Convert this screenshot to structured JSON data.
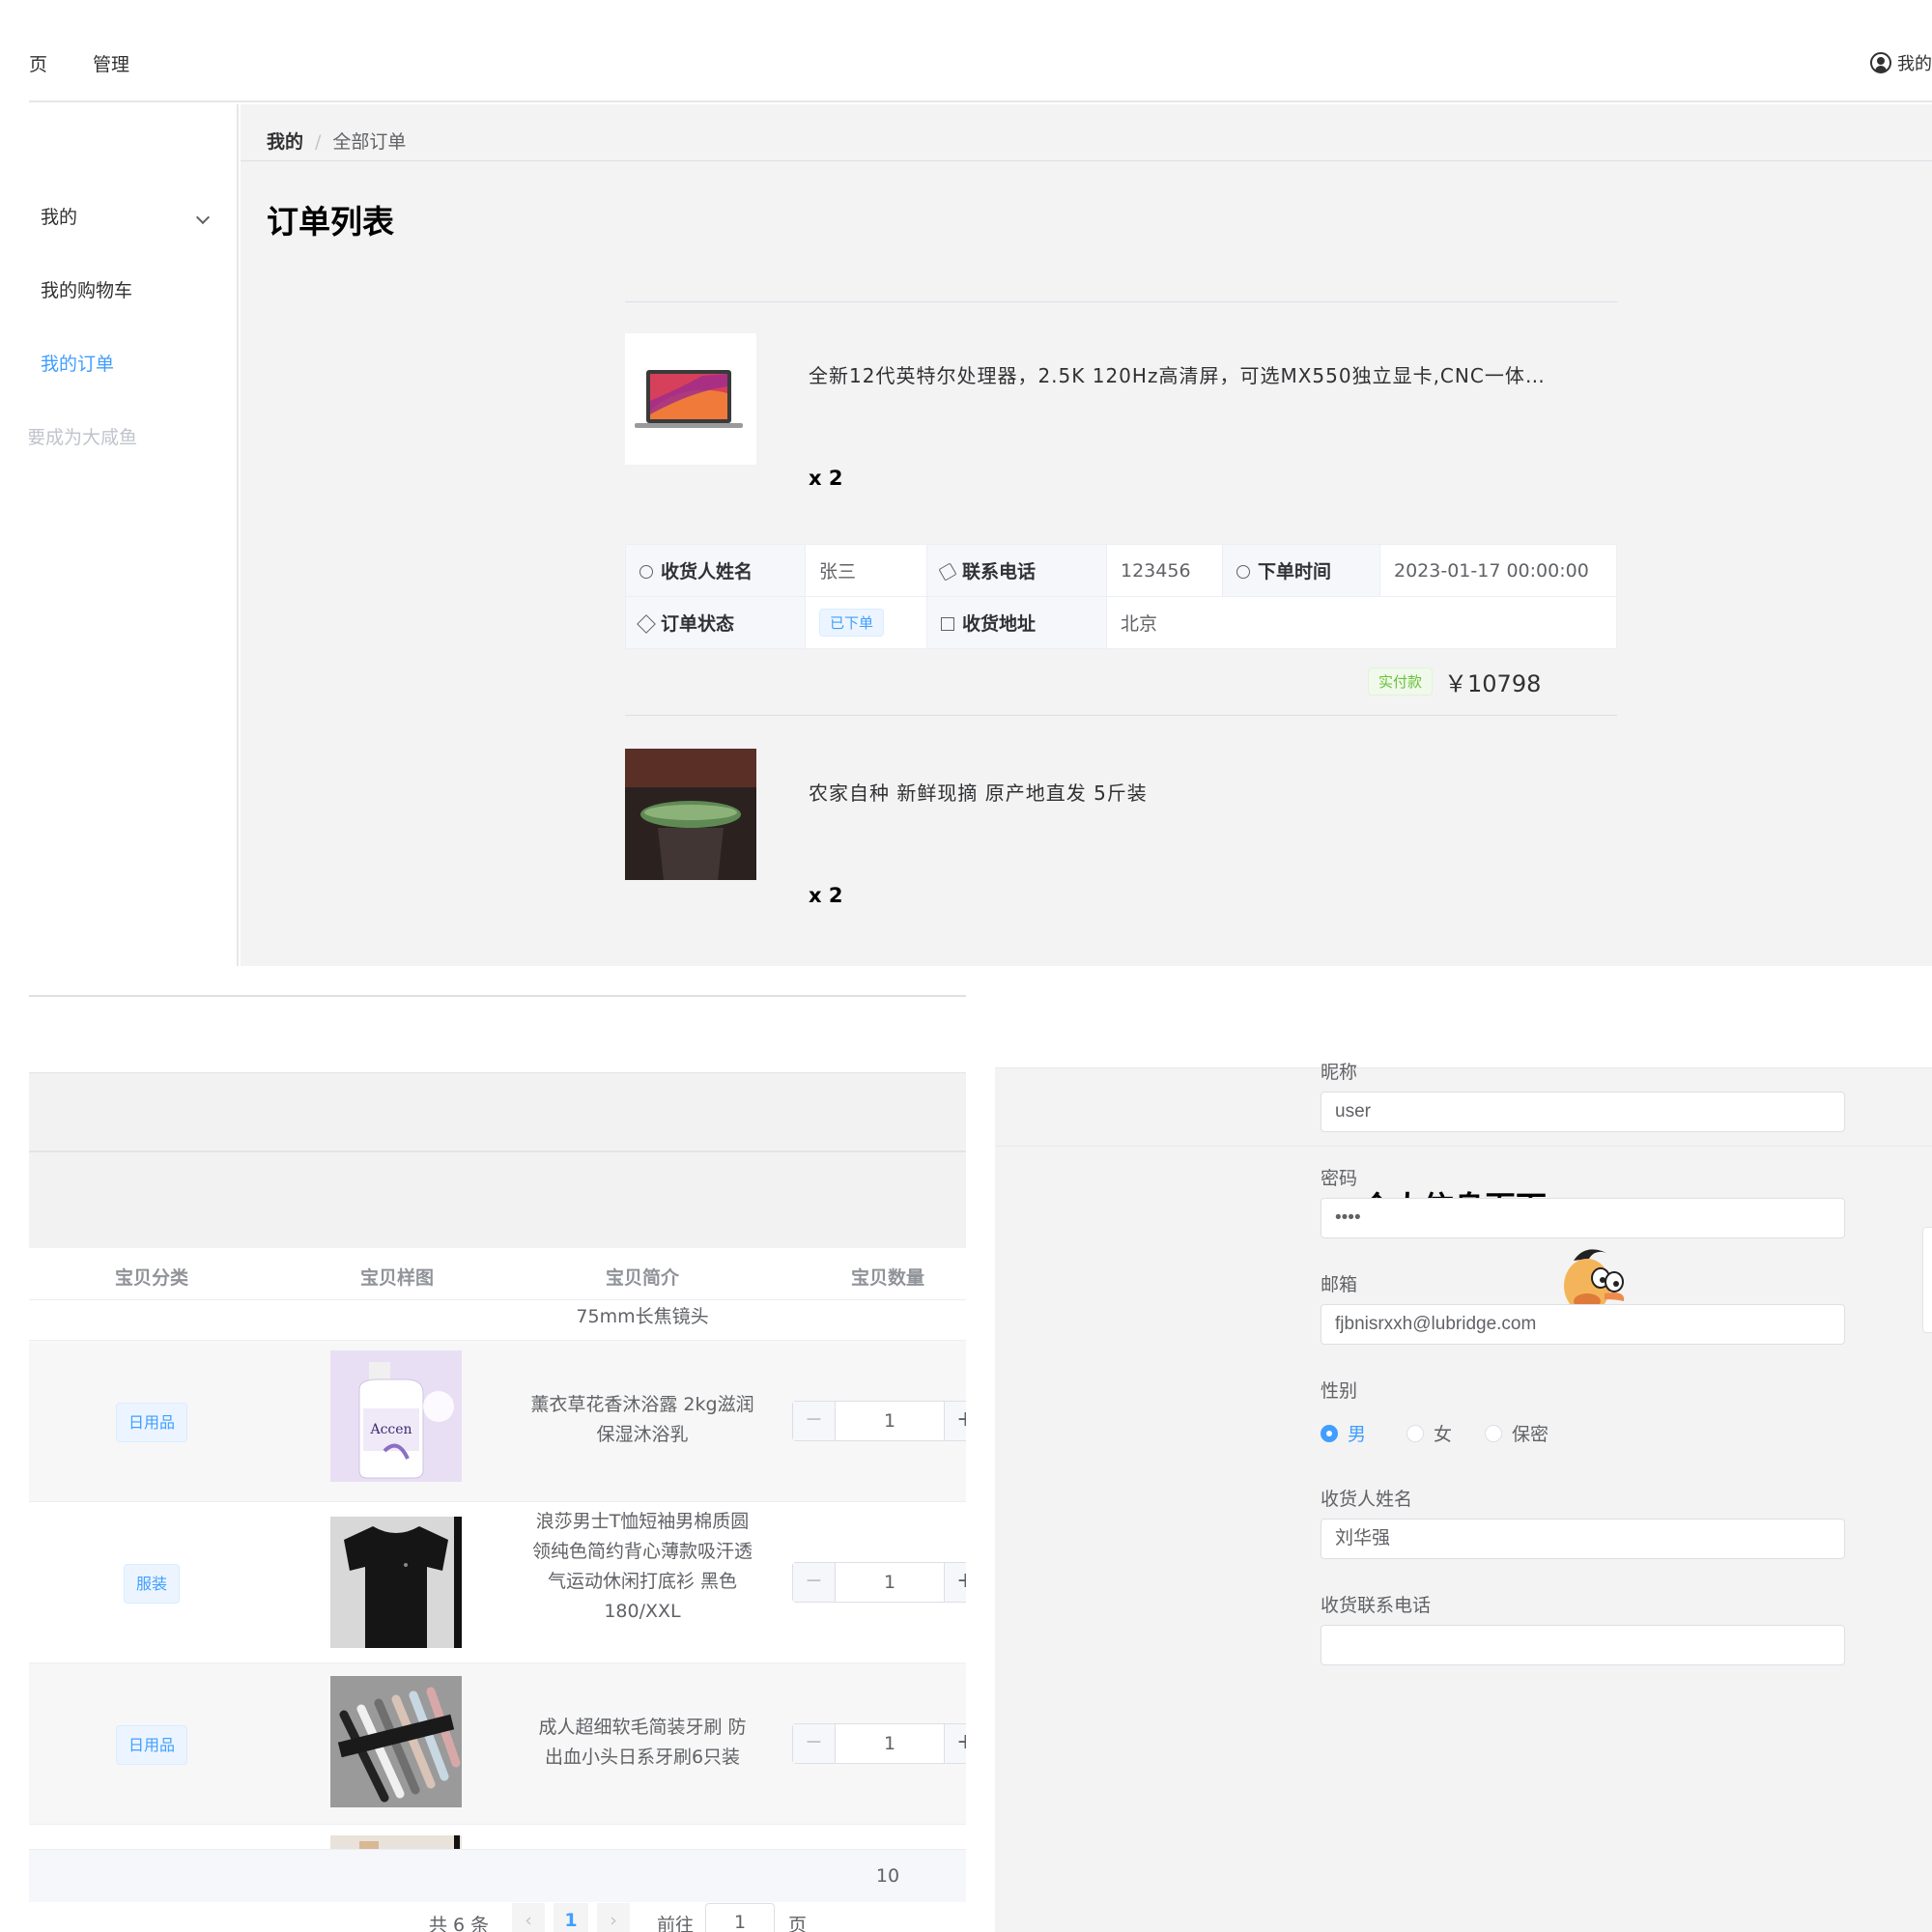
{
  "topbar": {
    "nav_partial": "页",
    "nav_manage": "管理",
    "user_label": "我的"
  },
  "sidebar": {
    "items": [
      {
        "label": "我的"
      },
      {
        "label": "我的购物车"
      },
      {
        "label": "我的订单"
      },
      {
        "label": "我要成为大咸鱼"
      }
    ],
    "visible_partial": "要成为大咸鱼"
  },
  "breadcrumb": {
    "root": "我的",
    "sep": "/",
    "current": "全部订单"
  },
  "orders_page": {
    "title": "订单列表",
    "orders": [
      {
        "product_name": "全新12代英特尔处理器，2.5K 120Hz高清屏，可选MX550独立显卡,CNC一体…",
        "quantity": "x 2",
        "receiver_label": "收货人姓名",
        "receiver": "张三",
        "phone_label": "联系电话",
        "phone": "123456",
        "time_label": "下单时间",
        "time": "2023-01-17 00:00:00",
        "status_label": "订单状态",
        "status": "已下单",
        "address_label": "收货地址",
        "address": "北京",
        "paid_label": "实付款",
        "price": "￥10798"
      },
      {
        "product_name": "农家自种 新鲜现摘 原产地直发 5斤装",
        "quantity": "x 2"
      }
    ]
  },
  "cart": {
    "columns": [
      "宝贝分类",
      "宝贝样图",
      "宝贝简介",
      "宝贝数量"
    ],
    "partial_row_text": "75mm长焦镜头",
    "rows": [
      {
        "category": "日用品",
        "desc": "薰衣草花香沐浴露 2kg滋润保湿沐浴乳",
        "qty": "1"
      },
      {
        "category": "服装",
        "desc": "浪莎男士T恤短袖男棉质圆领纯色简约背心薄款吸汗透气运动休闲打底衫 黑色 180/XXL",
        "qty": "1"
      },
      {
        "category": "日用品",
        "desc": "成人超细软毛简装牙刷 防出血小头日系牙刷6只装",
        "qty": "1"
      }
    ],
    "footer_total_qty": "10",
    "pager": {
      "total": "共 6 条",
      "prev": "‹",
      "page": "1",
      "next": "›",
      "goto_label": "前往",
      "goto_value": "1",
      "page_unit": "页"
    }
  },
  "profile": {
    "title": "个人信息页面",
    "nickname_label": "昵称",
    "nickname": "user",
    "password_label": "密码",
    "password": "••••",
    "email_label": "邮箱",
    "email": "fjbnisrxxh@lubridge.com",
    "gender_label": "性别",
    "gender_options": [
      "男",
      "女",
      "保密"
    ],
    "receiver_label": "收货人姓名",
    "receiver": "刘华强",
    "phone_label": "收货联系电话"
  },
  "colors": {
    "accent": "#409eff",
    "success": "#67c23a",
    "panel_bg": "#f3f3f3"
  }
}
